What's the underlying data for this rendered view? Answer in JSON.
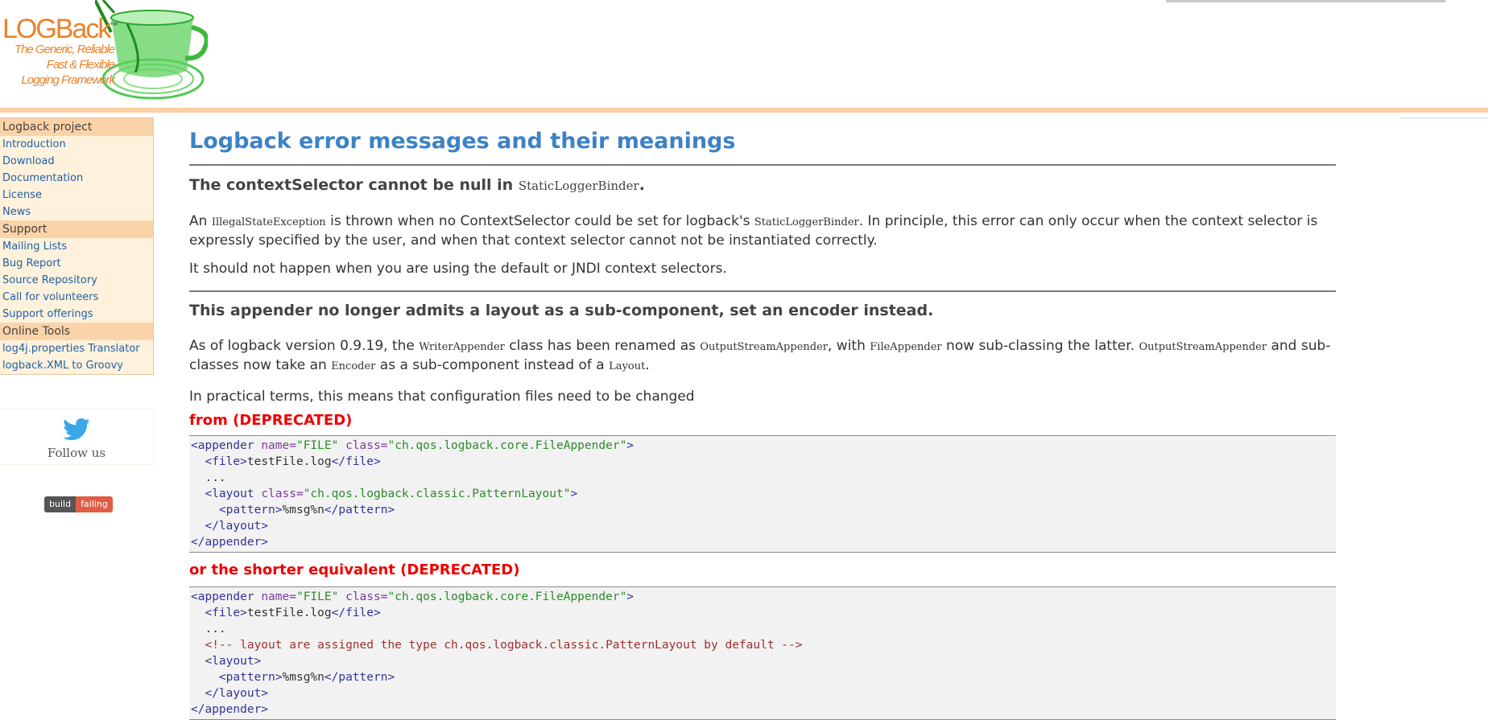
{
  "logo": {
    "wordmark": "LOGBack",
    "trademark": "™",
    "tagline_lines": [
      "The Generic, Reliable",
      "Fast & Flexible",
      "Logging Framework"
    ]
  },
  "sidebar": {
    "groups": [
      {
        "title": "Logback project",
        "items": [
          "Introduction",
          "Download",
          "Documentation",
          "License",
          "News"
        ]
      },
      {
        "title": "Support",
        "items": [
          "Mailing Lists",
          "Bug Report",
          "Source Repository",
          "Call for volunteers",
          "Support offerings"
        ]
      },
      {
        "title": "Online Tools",
        "items": [
          "log4j.properties Translator",
          "logback.XML to Groovy"
        ]
      }
    ],
    "follow_label": "Follow us",
    "badge": {
      "left": "build",
      "right": "failing"
    }
  },
  "content": {
    "title": "Logback error messages and their meanings",
    "section1": {
      "heading_text": "The contextSelector cannot be null in",
      "heading_code": "StaticLoggerBinder",
      "heading_end": ".",
      "p1_a": "An ",
      "p1_code1": "IllegalStateException",
      "p1_b": " is thrown when no ContextSelector could be set for logback's ",
      "p1_code2": "StaticLoggerBinder",
      "p1_c": ". In principle, this error can only occur when the context selector is expressly specified by the user, and when that context selector cannot not be instantiated correctly.",
      "p2": "It should not happen when you are using the default or JNDI context selectors."
    },
    "section2": {
      "heading": "This appender no longer admits a layout as a sub-component, set an encoder instead.",
      "p1_a": "As of logback version 0.9.19, the ",
      "p1_code1": "WriterAppender",
      "p1_b": " class has been renamed as ",
      "p1_code2": "OutputStreamAppender",
      "p1_c": ", with ",
      "p1_code3": "FileAppender",
      "p1_d": " now sub-classing the latter. ",
      "p1_code4": "OutputStreamAppender",
      "p1_e": " and sub-classes now take an ",
      "p1_code5": "Encoder",
      "p1_f": " as a sub-component instead of a ",
      "p1_code6": "Layout",
      "p1_g": ".",
      "p2": "In practical terms, this means that configuration files need to be changed",
      "from_label": "from (DEPRECATED)",
      "shorter_label": "or the shorter equivalent (DEPRECATED)"
    }
  }
}
